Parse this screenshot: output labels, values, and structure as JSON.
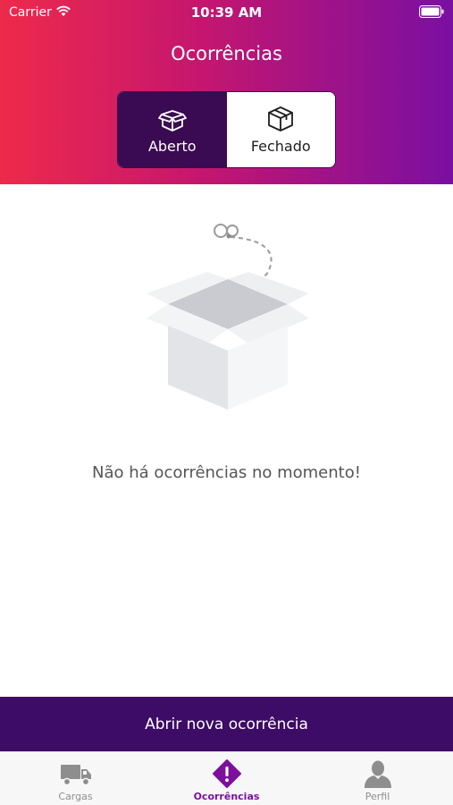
{
  "status_bar": {
    "carrier": "Carrier",
    "time": "10:39 AM"
  },
  "nav": {
    "title": "Ocorrências"
  },
  "segment": {
    "options": [
      {
        "label": "Aberto",
        "icon": "open-box-icon",
        "selected": true
      },
      {
        "label": "Fechado",
        "icon": "closed-box-icon",
        "selected": false
      }
    ]
  },
  "empty_state": {
    "illustration": "empty-box-illustration",
    "message": "Não há ocorrências no momento!"
  },
  "cta": {
    "label": "Abrir nova ocorrência"
  },
  "tabbar": {
    "items": [
      {
        "label": "Cargas",
        "icon": "truck-icon",
        "active": false
      },
      {
        "label": "Ocorrências",
        "icon": "alert-diamond-icon",
        "active": true
      },
      {
        "label": "Perfil",
        "icon": "user-icon",
        "active": false
      }
    ]
  },
  "colors": {
    "header_gradient": [
      "#ee2a4b",
      "#c4166f",
      "#7a0fa2"
    ],
    "segment_active": "#3a0a52",
    "cta_background": "#3d0c66",
    "tab_active": "#7d0f9d",
    "tab_inactive": "#8e8e8e"
  }
}
